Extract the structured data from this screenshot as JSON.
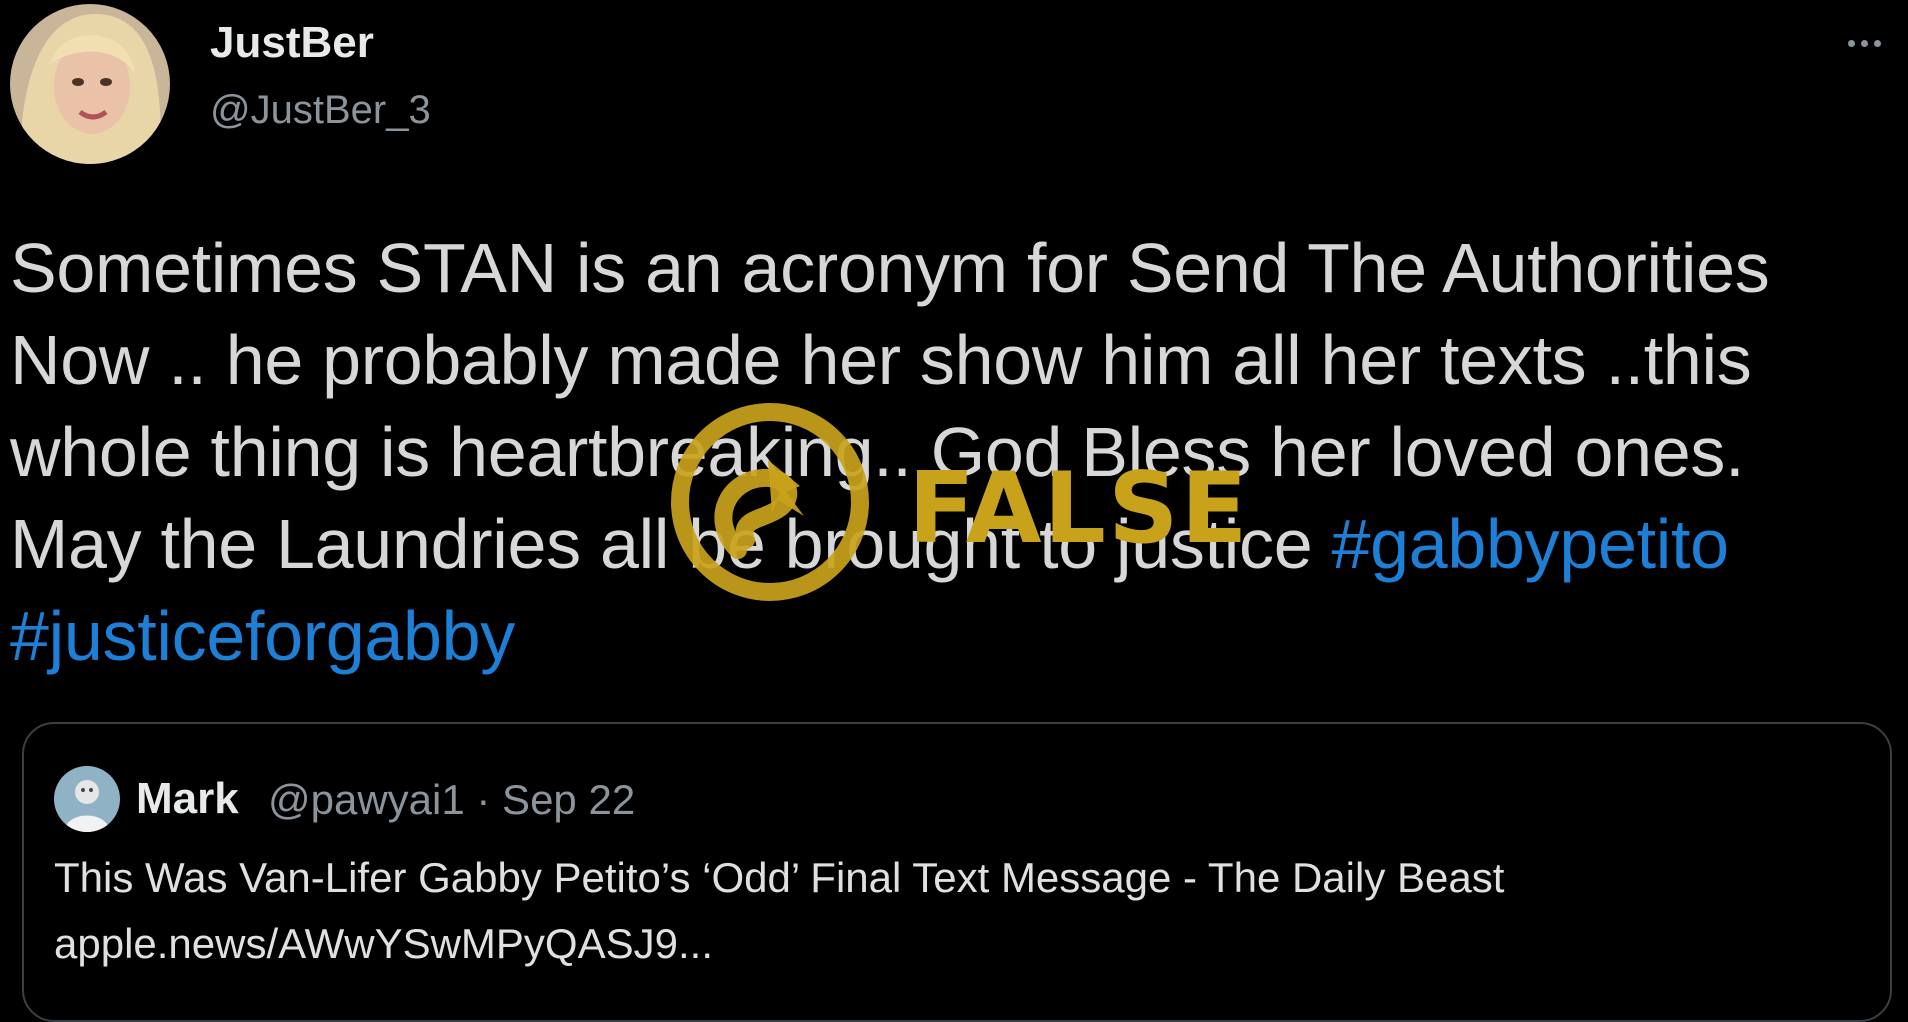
{
  "tweet": {
    "author_name": "JustBer",
    "author_handle": "@JustBer_3",
    "text_plain": "Sometimes STAN is an acronym for Send The Authorities Now .. he probably made her show him all her texts ..this whole thing is heartbreaking.. God Bless her loved ones. May the Laundries all be brought to justice ",
    "hashtags": [
      "#gabbypetito",
      "#justiceforgabby"
    ],
    "more_icon": "more-horizontal-icon"
  },
  "quote": {
    "author_name": "Mark",
    "meta": "@pawyai1 · Sep 22",
    "headline": "This Was Van-Lifer Gabby Petito’s ‘Odd’ Final Text Message - The Daily Beast",
    "link": "apple.news/AWwYSwMPyQASJ9..."
  },
  "stamp": {
    "label": "FALSE",
    "icon": "fact-check-logo",
    "color": "#c9a21b"
  },
  "colors": {
    "background": "#000000",
    "hashtag": "#1d7fd6",
    "muted": "#8b949b",
    "border": "#3a3f44"
  }
}
